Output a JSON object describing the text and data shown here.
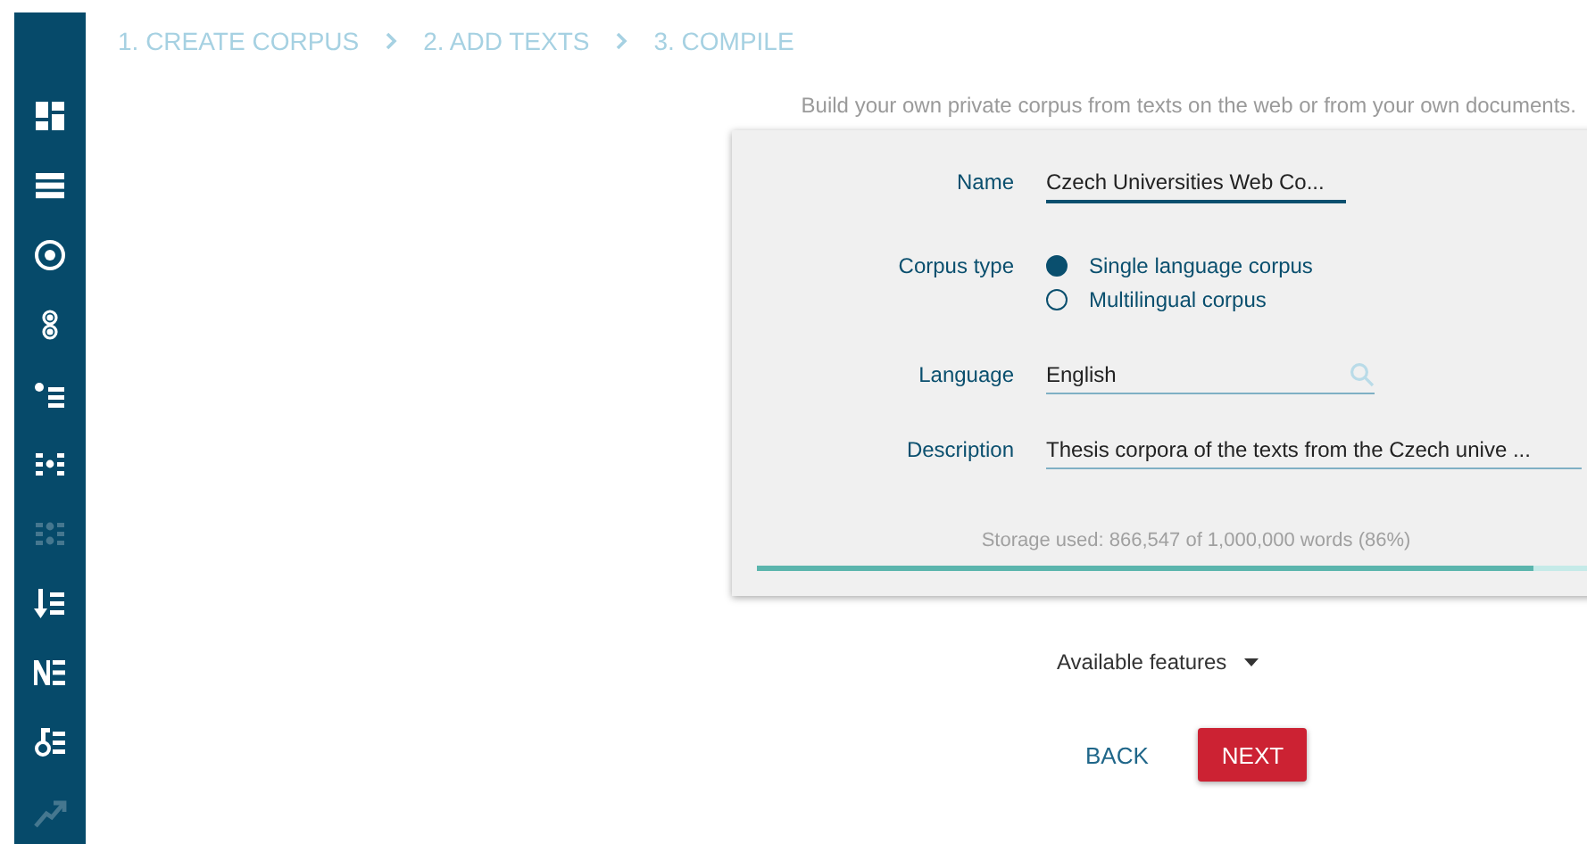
{
  "sidebar": {
    "items": [
      {
        "disabled": false
      },
      {
        "disabled": false
      },
      {
        "disabled": false
      },
      {
        "disabled": false
      },
      {
        "disabled": false
      },
      {
        "disabled": false
      },
      {
        "disabled": true
      },
      {
        "disabled": false
      },
      {
        "disabled": false
      },
      {
        "disabled": false
      },
      {
        "disabled": true
      }
    ]
  },
  "steps": [
    {
      "label": "1. CREATE CORPUS"
    },
    {
      "label": "2. ADD TEXTS"
    },
    {
      "label": "3. COMPILE"
    }
  ],
  "intro": "Build your own private corpus from texts on the web or from your own documents.",
  "form": {
    "name": {
      "label": "Name",
      "value": "Czech Universities Web Co..."
    },
    "corpus_type": {
      "label": "Corpus type",
      "options": [
        {
          "label": "Single language corpus",
          "selected": true
        },
        {
          "label": "Multilingual corpus",
          "selected": false
        }
      ]
    },
    "language": {
      "label": "Language",
      "value": "English"
    },
    "description": {
      "label": "Description",
      "value": "Thesis corpora of the texts from the Czech unive ..."
    },
    "storage": {
      "text": "Storage used: 866,547 of 1,000,000 words (86%)",
      "level": 0.86
    }
  },
  "features": {
    "label": "Available features"
  },
  "buttons": [
    {
      "label": "BACK",
      "kind": "flat"
    },
    {
      "label": "NEXT",
      "kind": "raised"
    }
  ]
}
